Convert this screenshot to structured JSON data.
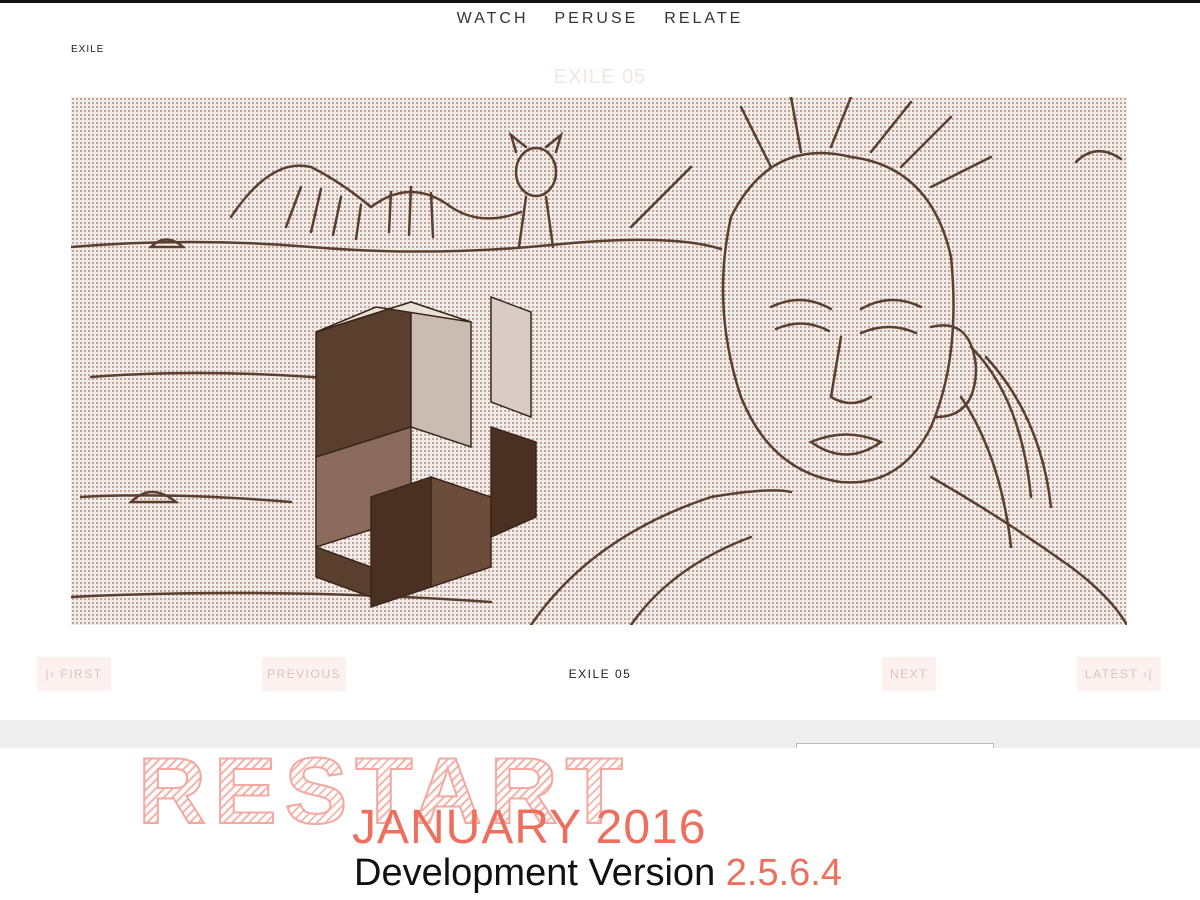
{
  "nav": {
    "items": [
      "WATCH",
      "PERUSE",
      "RELATE"
    ]
  },
  "breadcrumb": "EXILE",
  "page": {
    "title": "EXILE 05",
    "comic_alt_wordmark": "EXILE"
  },
  "pager": {
    "first": "|‹ FIRST",
    "previous": "PREVIOUS",
    "current": "EXILE 05",
    "next": "NEXT",
    "latest": "LATEST ›|"
  },
  "banner": {
    "restart": "RESTART",
    "date": "JANUARY 2016",
    "version_prefix": "Development Version",
    "version_number": "2.5.6.4"
  },
  "colors": {
    "accent": "#ee6f5e",
    "ink": "#5a3e2e",
    "paper": "#f3ebe7",
    "button_bg": "#fdf1f0",
    "button_text": "#dcc2bd"
  }
}
